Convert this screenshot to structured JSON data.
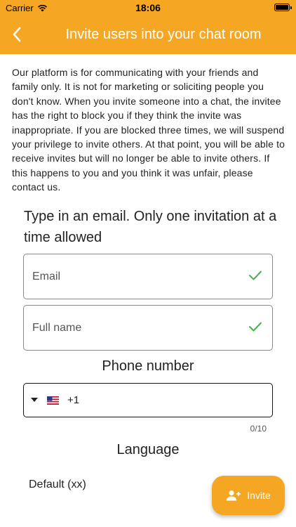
{
  "status_bar": {
    "carrier": "Carrier",
    "time": "18:06"
  },
  "app_bar": {
    "title": "Invite users into your chat room",
    "back_icon": "chevron-left-icon"
  },
  "notice": "Our platform is for communicating with your friends and family only. It is not for marketing or soliciting people you don't know. When you invite someone into a chat, the invitee has the right to block you if they think the invite was inappropriate. If you are blocked three times, we will suspend your privilege to invite others. At that point, you will be able to receive invites but will no longer be able to invite others. If this happens to you and you think it was unfair, please contact us.",
  "instruction": "Type in an email. Only one invitation at a time allowed",
  "email_field": {
    "placeholder": "Email",
    "valid": true
  },
  "name_field": {
    "placeholder": "Full name",
    "valid": true
  },
  "phone": {
    "label": "Phone number",
    "country_code": "+1",
    "flag": "us-flag-icon",
    "counter": "0/10"
  },
  "language": {
    "label": "Language",
    "value": "Default (xx)"
  },
  "invite_button": {
    "label": "Invite",
    "icon": "person-add-icon"
  },
  "colors": {
    "accent": "#f5a623",
    "check": "#4caf50"
  }
}
